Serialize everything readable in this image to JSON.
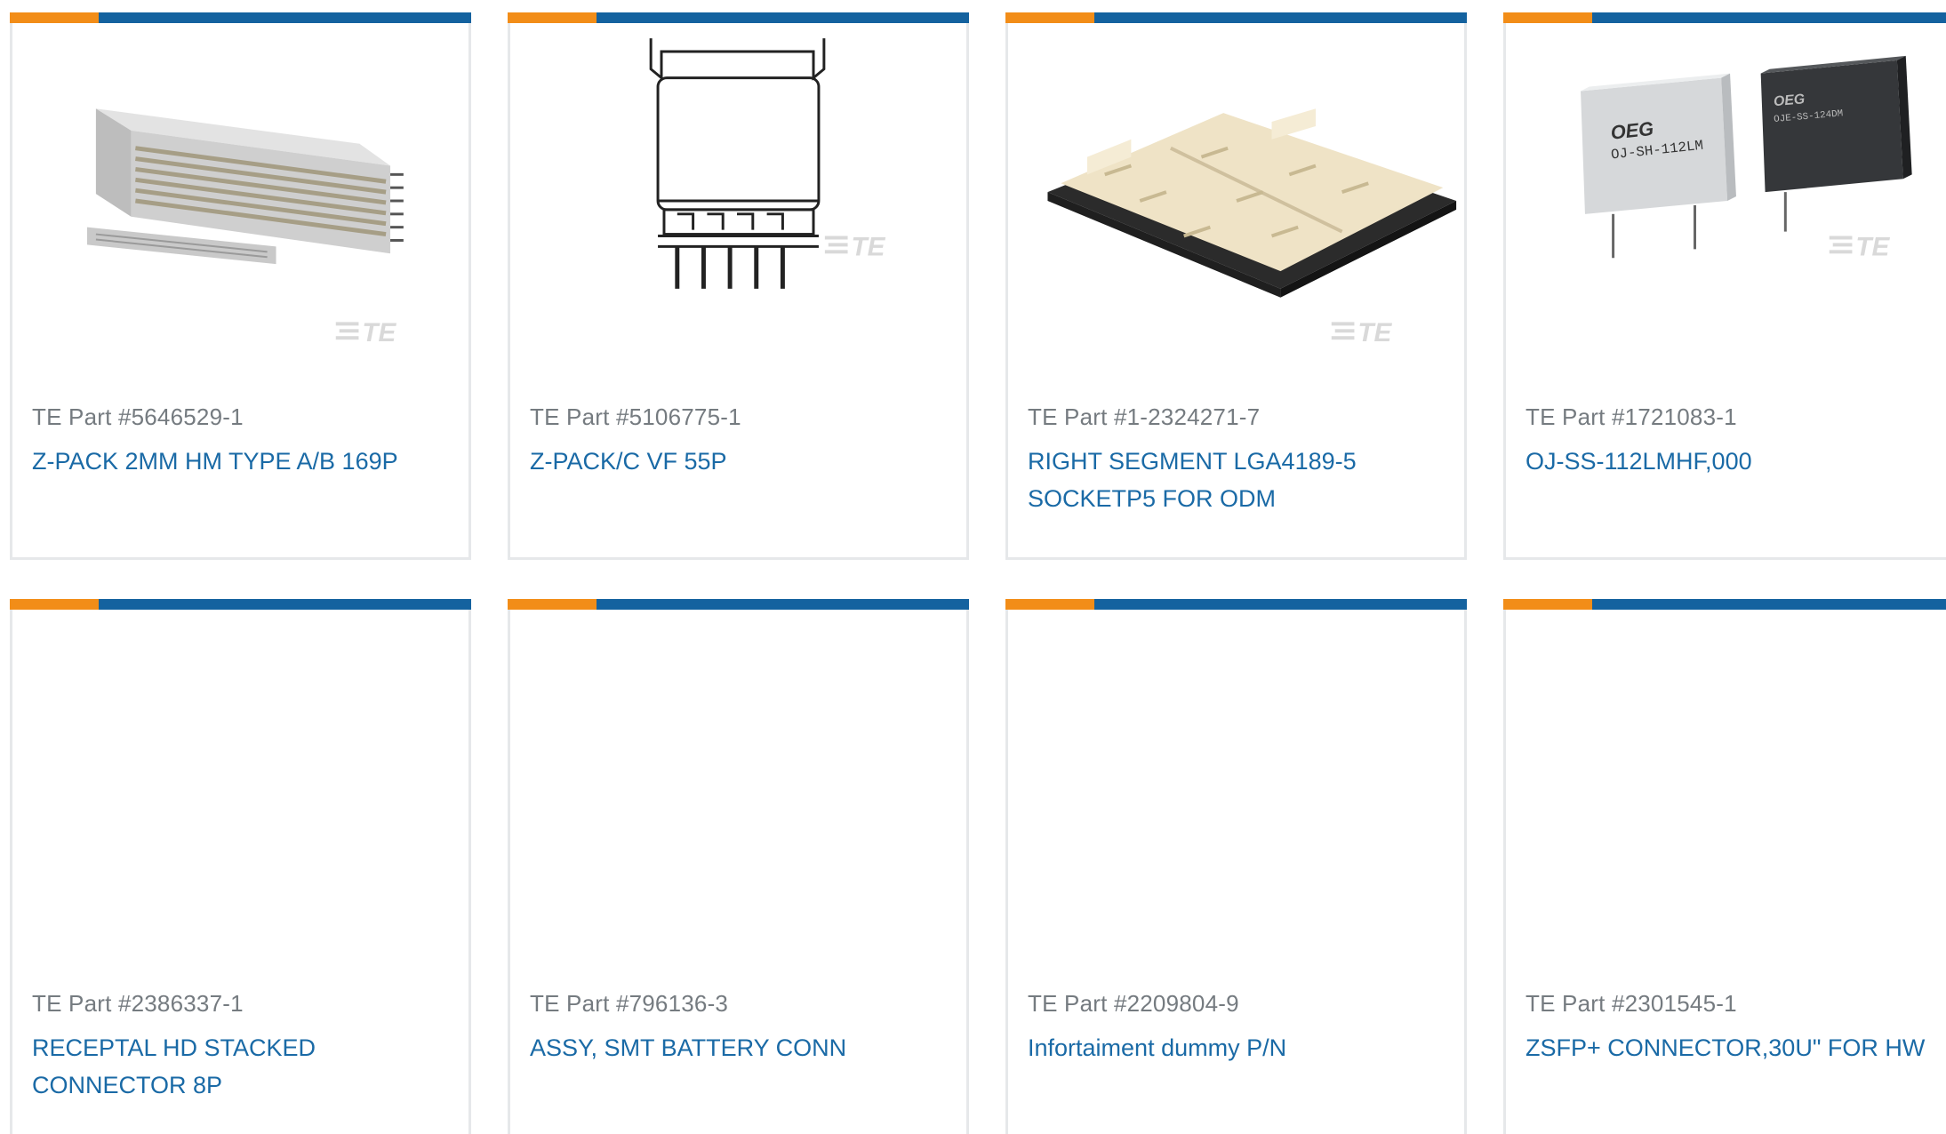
{
  "colors": {
    "accent_orange": "#f28d18",
    "accent_blue": "#14629f",
    "link": "#1a6aa6",
    "part_number": "#757b80",
    "card_border": "#e6e8ea"
  },
  "products": [
    {
      "part_number": "TE Part #5646529-1",
      "name": "Z-PACK 2MM HM TYPE A/B 169P",
      "image": "backplane-connector-image",
      "watermark": "TE"
    },
    {
      "part_number": "TE Part #5106775-1",
      "name": "Z-PACK/C VF 55P",
      "image": "connector-line-drawing-image",
      "watermark": "TE"
    },
    {
      "part_number": "TE Part #1-2324271-7",
      "name": "RIGHT SEGMENT LGA4189-5 SOCKETP5 FOR ODM",
      "image": "lga-socket-image",
      "watermark": "TE"
    },
    {
      "part_number": "TE Part #1721083-1",
      "name": "OJ-SS-112LMHF,000",
      "image": "relay-image",
      "watermark": "TE",
      "relay_labels": [
        "OEG",
        "OJ-SH-112LM",
        "OEG",
        "OJE-SS-124DM"
      ]
    },
    {
      "part_number": "TE Part #2386337-1",
      "name": "RECEPTAL HD STACKED CONNECTOR 8P"
    },
    {
      "part_number": "TE Part #796136-3",
      "name": "ASSY, SMT BATTERY CONN"
    },
    {
      "part_number": "TE Part #2209804-9",
      "name": "Infortaiment dummy P/N"
    },
    {
      "part_number": "TE Part #2301545-1",
      "name": "ZSFP+ CONNECTOR,30U\" FOR HW"
    }
  ]
}
